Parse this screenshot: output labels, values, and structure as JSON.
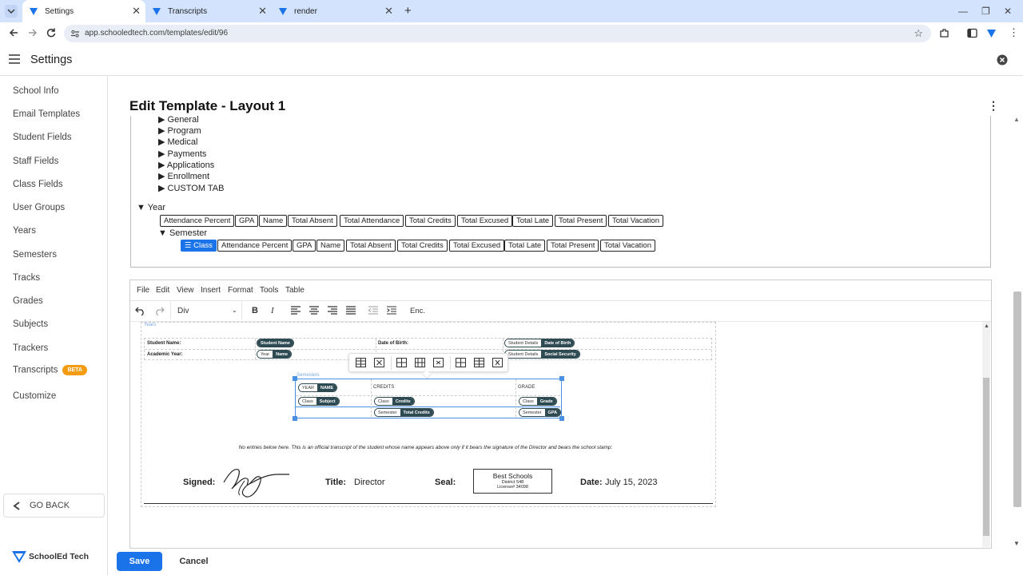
{
  "browser": {
    "tabs": [
      {
        "title": "Settings"
      },
      {
        "title": "Transcripts"
      },
      {
        "title": "render"
      }
    ],
    "url": "app.schooledtech.com/templates/edit/96"
  },
  "app": {
    "title": "Settings",
    "brand": "SchoolEd Tech"
  },
  "sidebar": {
    "items": [
      {
        "label": "School Info"
      },
      {
        "label": "Email Templates"
      },
      {
        "label": "Student Fields"
      },
      {
        "label": "Staff Fields"
      },
      {
        "label": "Class Fields"
      },
      {
        "label": "User Groups"
      },
      {
        "label": "Years"
      },
      {
        "label": "Semesters"
      },
      {
        "label": "Tracks"
      },
      {
        "label": "Grades"
      },
      {
        "label": "Subjects"
      },
      {
        "label": "Trackers"
      },
      {
        "label": "Transcripts",
        "badge": "BETA"
      },
      {
        "label": "Customize"
      }
    ],
    "go_back": "GO BACK"
  },
  "page": {
    "title": "Edit Template - Layout 1"
  },
  "tree": {
    "sections": [
      "General",
      "Program",
      "Medical",
      "Payments",
      "Applications",
      "Enrollment",
      "CUSTOM TAB"
    ],
    "year_label": "Year",
    "year_fields": [
      "Attendance Percent",
      "GPA",
      "Name",
      "Total Absent",
      "Total Attendance",
      "Total Credits",
      "Total Excused",
      "Total Late",
      "Total Present",
      "Total Vacation"
    ],
    "semester_label": "Semester",
    "class_chip": "Class",
    "semester_fields": [
      "Attendance Percent",
      "GPA",
      "Name",
      "Total Absent",
      "Total Credits",
      "Total Excused",
      "Total Late",
      "Total Present",
      "Total Vacation"
    ]
  },
  "editor": {
    "menu": [
      "File",
      "Edit",
      "View",
      "Insert",
      "Format",
      "Tools",
      "Table"
    ],
    "block_format": "Div",
    "enc": "Enc.",
    "years_label": "Years",
    "semesters_label": "Semesters",
    "student_name_label": "Student Name:",
    "student_name_pill": "Student Name",
    "dob_label": "Date of Birth:",
    "dob_pill_l": "Student Details",
    "dob_pill_r": "Date of Birth",
    "academic_year_label": "Academic Year:",
    "ay_pill_l": "Year",
    "ay_pill_r": "Name",
    "ss_pill_l": "Student Details",
    "ss_pill_r": "Social Security",
    "row1": {
      "a_l": "YEAR",
      "a_r": "NAME",
      "b": "CREDITS",
      "c": "GRADE"
    },
    "row2": {
      "a_l": "Class",
      "a_r": "Subject",
      "b_l": "Class",
      "b_r": "Credits",
      "c_l": "Class",
      "c_r": "Grade"
    },
    "row3": {
      "b_l": "Semester",
      "b_r": "Total Credits",
      "c_l": "Semester",
      "c_r": "GPA"
    },
    "note": "No entries below here. This is an official transcript of the student whose name appears above only if it bears the signature of the Director and bears the school stamp:",
    "signed_label": "Signed:",
    "title_label": "Title:",
    "title_value": "Director",
    "seal_label": "Seal:",
    "seal_line1": "Best Schools",
    "seal_line2": "District 548",
    "seal_line3": "License# 34098",
    "date_label": "Date:",
    "date_value": "July 15, 2023"
  },
  "actions": {
    "save": "Save",
    "cancel": "Cancel"
  },
  "colors": {
    "accent": "#1a73e8",
    "pill": "#2e4a52",
    "beta": "#f39c12",
    "tabbar": "#d3e3fd"
  }
}
